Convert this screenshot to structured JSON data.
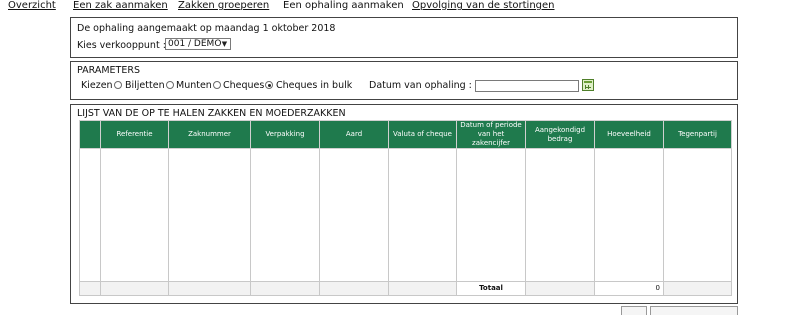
{
  "nav": {
    "overzicht": "Overzicht",
    "zak_aanmaken": "Een zak aanmaken",
    "zakken_groeperen": "Zakken groeperen",
    "ophaling_aanmaken": "Een ophaling aanmaken",
    "opvolging": "Opvolging van de stortingen"
  },
  "header_panel": {
    "created_text": "De ophaling aangemaakt op maandag 1 oktober 2018",
    "verkooppunt_label": "Kies verkooppunt :",
    "verkooppunt_value": "001 / DEMO"
  },
  "parameters": {
    "title": "PARAMETERS",
    "kiezen_label": "Kiezen",
    "options": [
      "Biljetten",
      "Munten",
      "Cheques",
      "Cheques in bulk"
    ],
    "selected": "Cheques in bulk",
    "datum_label": "Datum van ophaling :",
    "datum_value": ""
  },
  "list": {
    "title": "LIJST VAN DE OP TE HALEN ZAKKEN EN MOEDERZAKKEN",
    "columns": [
      "",
      "Referentie",
      "Zaknummer",
      "Verpakking",
      "Aard",
      "Valuta of cheque",
      "Datum of periode van het zakencijfer",
      "Aangekondigd bedrag",
      "Hoeveelheid",
      "Tegenpartij"
    ],
    "total_label": "Totaal",
    "total_value": "0"
  },
  "colors": {
    "header_green": "#1f7a4d",
    "border": "#444444"
  },
  "icons": {
    "calendar": "calendar-icon",
    "dropdown": "chevron-down-icon"
  }
}
